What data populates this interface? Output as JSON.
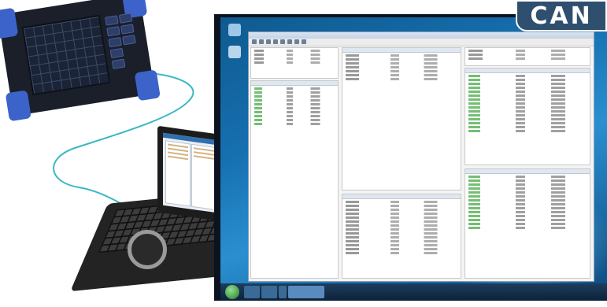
{
  "badge": {
    "label": "CAN",
    "color": "#2f4f6f"
  },
  "colors": {
    "cable": "#3ab8c4",
    "bumper": "#3b63c9",
    "desktop": "#1670b0"
  },
  "icons": [
    "recorder-device-icon",
    "laptop-icon",
    "monitor-icon",
    "start-orb-icon"
  ]
}
